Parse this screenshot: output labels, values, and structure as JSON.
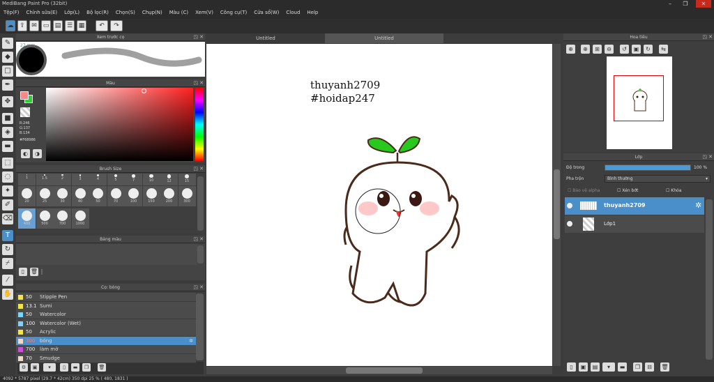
{
  "app": {
    "title": "MediBang Paint Pro (32bit)"
  },
  "menu": [
    "Tệp(F)",
    "Chỉnh sửa(E)",
    "Lớp(L)",
    "Bộ lọc(R)",
    "Chọn(S)",
    "Chụp(N)",
    "Màu (C)",
    "Xem(V)",
    "Công cụ(T)",
    "Cửa sổ(W)",
    "Cloud",
    "Help"
  ],
  "panels": {
    "preview": "Xem trước cọ",
    "color": "Màu",
    "brush_size": "Brush Size",
    "palette": "Bảng màu",
    "brush_list": "Cọ: bóng",
    "navigator": "Hoa tiêu",
    "layers": "Lớp"
  },
  "preview": {
    "size_label": "27 mm"
  },
  "color": {
    "r": "R:246",
    "g": "G:137",
    "b": "B:134",
    "hex": "#F68986",
    "fg": "#F68986",
    "bg": "#27d52b",
    "hue": "#ff2020"
  },
  "brush_sizes": [
    "1",
    "1.5",
    "2",
    "3",
    "4",
    "5",
    "7",
    "10",
    "12",
    "15",
    "20",
    "25",
    "30",
    "40",
    "50",
    "70",
    "100",
    "150",
    "200",
    "300",
    "400",
    "500",
    "700",
    "1000"
  ],
  "brushes": [
    {
      "num": "50",
      "name": "Stipple Pen",
      "color": "#f3e44a"
    },
    {
      "num": "13.1",
      "name": "Sumi",
      "color": "#f3e44a"
    },
    {
      "num": "50",
      "name": "Watercolor",
      "color": "#7fd3f7"
    },
    {
      "num": "100",
      "name": "Watercolor (Wet)",
      "color": "#7fd3f7"
    },
    {
      "num": "50",
      "name": "Acrylic",
      "color": "#f3e44a"
    },
    {
      "num": "300",
      "name": "bóng",
      "color": "#f2d9d0"
    },
    {
      "num": "700",
      "name": "làm mờ",
      "color": "#c850d8"
    },
    {
      "num": "70",
      "name": "Smudge",
      "color": "#f0dcc8"
    }
  ],
  "tabs": [
    "Untitled",
    "Untitled"
  ],
  "canvas": {
    "watermark_line1": "thuyanh2709",
    "watermark_line2": "#hoidap247"
  },
  "layers": {
    "opacity_label": "Độ trong",
    "opacity_value": "100 %",
    "blend_label": "Pha trộn",
    "blend_value": "Bình thường",
    "opt_protect": "Bảo vệ alpha",
    "opt_clip": "Xén bớt",
    "opt_lock": "Khóa",
    "items": [
      "thuyanh2709",
      "Lớp1"
    ]
  },
  "status": {
    "text": "4092 * 5787 pixel   (29.7 * 42cm)  350 dpi  25 %   ( 480, 1831 )"
  }
}
